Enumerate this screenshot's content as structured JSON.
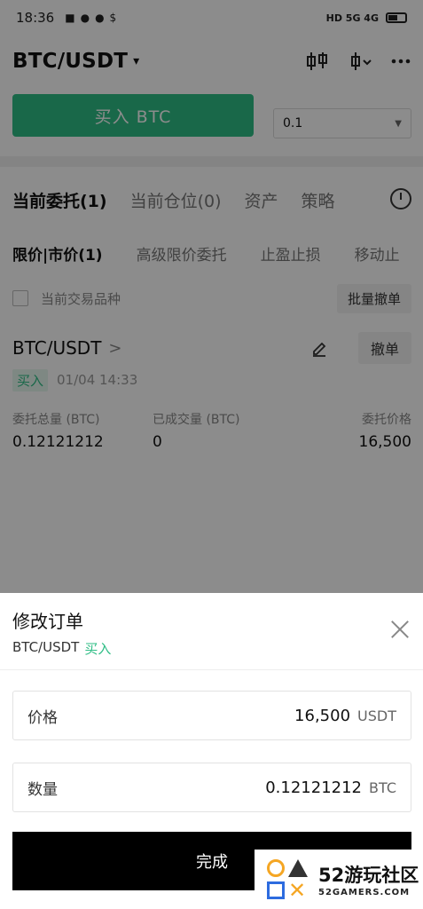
{
  "status_bar": {
    "time": "18:36",
    "left_icons": [
      "■",
      "●",
      "●",
      "$"
    ],
    "right_text": "HD 5G 4G"
  },
  "header": {
    "pair": "BTC/USDT",
    "caret": "▾",
    "icons": [
      "candlestick-icon",
      "indicator-icon",
      "more-icon"
    ]
  },
  "trade": {
    "buy_label": "买入 BTC",
    "quantity_value": "0.1",
    "buy_color": "#2ebd85"
  },
  "tabs": [
    "当前委托(1)",
    "当前仓位(0)",
    "资产",
    "策略"
  ],
  "subtabs": [
    "限价|市价(1)",
    "高级限价委托",
    "止盈止损",
    "移动止"
  ],
  "filter": {
    "label": "当前交易品种",
    "cancel_all": "批量撤单"
  },
  "order": {
    "pair": "BTC/USDT",
    "chevron": ">",
    "cancel": "撤单",
    "side": "买入",
    "time": "01/04 14:33",
    "columns": [
      {
        "label": "委托总量 (BTC)",
        "value": "0.12121212"
      },
      {
        "label": "已成交量 (BTC)",
        "value": "0"
      },
      {
        "label": "委托价格",
        "value": "16,500"
      }
    ]
  },
  "sheet": {
    "title": "修改订单",
    "pair": "BTC/USDT",
    "side": "买入",
    "price": {
      "label": "价格",
      "value": "16,500",
      "unit": "USDT"
    },
    "amount": {
      "label": "数量",
      "value": "0.12121212",
      "unit": "BTC"
    },
    "done": "完成"
  },
  "watermark": {
    "big": "52游玩社区",
    "small": "52GAMERS.COM"
  }
}
